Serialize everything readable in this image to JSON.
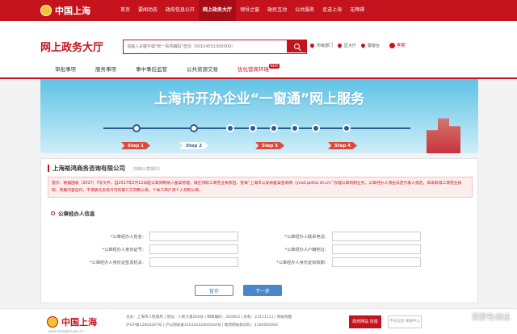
{
  "topbar": {
    "logo": "中国上海",
    "nav": [
      "首页",
      "要闻动态",
      "政府信息公开",
      "网上政务大厅",
      "领导之窗",
      "政民互动",
      "公共服务",
      "走进上海",
      "无障碍"
    ],
    "active_index": 3
  },
  "header": {
    "site_title": "网上政务大厅",
    "search_placeholder": "请输入关键字或\"统一事项编码\"查询（00104551300000）",
    "locations": [
      "市级部门",
      "区大厅",
      "警窗台"
    ],
    "user": "孝熙"
  },
  "subnav": {
    "items": [
      "审批事项",
      "服务事项",
      "事中事后监管",
      "公共资源交易",
      "优化营商环境"
    ],
    "new_badge": "NEW",
    "highlight_index": 4
  },
  "banner": {
    "title": "上海市开办企业“一窗通”网上服务",
    "steps": [
      "Step 1",
      "Step 2",
      "Step 3",
      "Step 4"
    ],
    "current_step": 2
  },
  "form": {
    "company_name": "上海裕鸿商务咨询有限公司",
    "company_sub": "（刻制公章报印）",
    "notice": "提示：根据国发〔2017〕7号文件，自2017年3月12日起公章刻制纳入备案管理，请在领取工商营业执照后，登录“上海市公安局备案查询网（ycxd.police.sh.cn）”办理公章刻制业务。公章经办人须由法定代表人指定，如未取得工商营业执照、所属内容自作，不得委托未经许可的第三方刻制公章。个体工商户须个人刻制公章。",
    "section_title": "公章经办人信息",
    "fields_left": [
      "*公章经办人姓名：",
      "*公章经办人身份证号：",
      "*公章经办人身份证签发机关："
    ],
    "fields_right": [
      "*公章经办人联系电话：",
      "*公章经办人户籍地址：",
      "*公章经办人身份证有效期："
    ],
    "save_label": "暂存",
    "next_label": "下一步"
  },
  "footer": {
    "logo": "中国上海",
    "url": "www.shanghai.gov.cn",
    "line1": "主办：上海市人民政府  |  地址：人民大道200号  |  邮政编码：200003  |  总机：23111111  |  网站地图",
    "line2": "沪ICP备12004267号  |  沪公网安备31010102004544号  |  政府网站标识码：3100000004",
    "badge1": "政府网站 找错",
    "badge2": "不良信息 举报中心"
  },
  "watermark": "百家号/创业",
  "colors": {
    "brand_red": "#c5131e",
    "banner_blue": "#5fc3e6",
    "step_blue": "#2c5d8f",
    "button_blue": "#4a86c8"
  }
}
